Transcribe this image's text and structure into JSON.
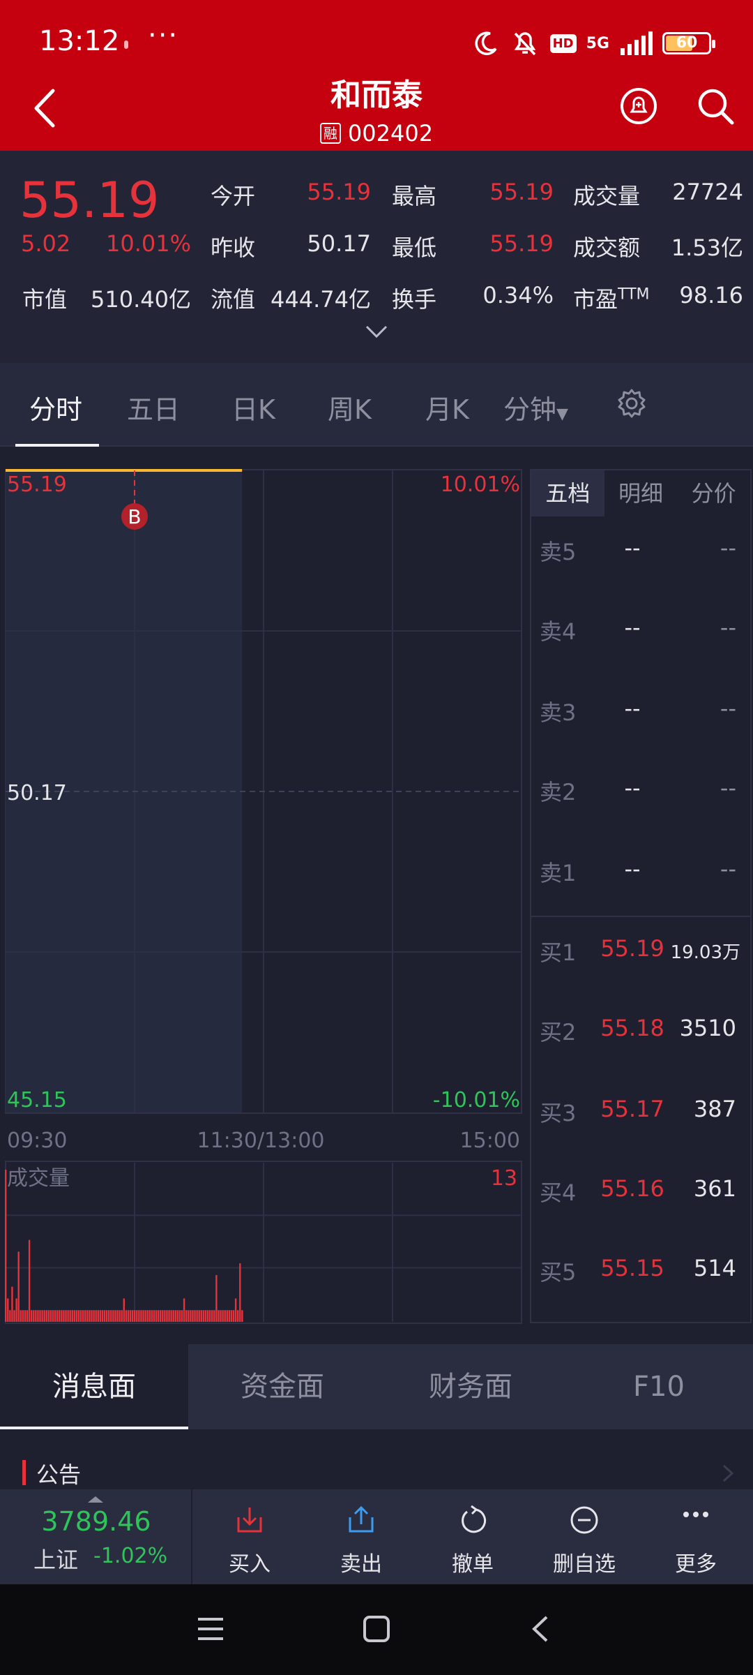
{
  "status_bar": {
    "time": "13:12",
    "more": "···",
    "hd": "HD",
    "net": "5G",
    "battery": "60"
  },
  "header": {
    "title": "和而泰",
    "badge": "融",
    "code": "002402"
  },
  "quote": {
    "price": "55.19",
    "change": "5.02",
    "change_pct": "10.01%",
    "open_label": "今开",
    "open": "55.19",
    "high_label": "最高",
    "high": "55.19",
    "volume_label": "成交量",
    "volume": "27724",
    "prev_close_label": "昨收",
    "prev_close": "50.17",
    "low_label": "最低",
    "low": "55.19",
    "amount_label": "成交额",
    "amount": "1.53亿",
    "mcap_label": "市值",
    "mcap": "510.40亿",
    "float_label": "流值",
    "float": "444.74亿",
    "turnover_label": "换手",
    "turnover": "0.34%",
    "pe_label": "市盈",
    "pe_sup": "TTM",
    "pe": "98.16"
  },
  "chart_tabs": [
    "分时",
    "五日",
    "日K",
    "周K",
    "月K",
    "分钟"
  ],
  "chart": {
    "top_price": "55.19",
    "top_pct": "10.01%",
    "mid_price": "50.17",
    "bottom_price": "45.15",
    "bottom_pct": "-10.01%",
    "marker": "B",
    "time_labels": [
      "09:30",
      "11:30/13:00",
      "15:00"
    ],
    "volume_label": "成交量",
    "volume_max": "13"
  },
  "chart_data": {
    "type": "line",
    "title": "",
    "ylim": [
      45.15,
      55.19
    ],
    "x": [
      0,
      1,
      20,
      40,
      60,
      80,
      100,
      110
    ],
    "series": [
      {
        "values": [
          55.19,
          55.19,
          55.19,
          55.19,
          55.19,
          55.19,
          55.19,
          55.19
        ]
      }
    ],
    "volume": [
      13,
      2,
      1,
      3,
      1,
      2,
      6,
      1,
      1,
      1,
      1,
      7,
      1,
      1,
      1,
      1,
      1,
      1,
      1,
      1,
      1,
      1,
      1,
      1,
      1,
      1,
      1,
      1,
      1,
      1,
      1,
      1,
      1,
      1,
      1,
      1,
      1,
      1,
      1,
      1,
      1,
      1,
      1,
      1,
      1,
      1,
      1,
      1,
      1,
      1,
      1,
      1,
      1,
      1,
      1,
      2,
      1,
      1,
      1,
      1,
      1,
      1,
      1,
      1,
      1,
      1,
      1,
      1,
      1,
      1,
      1,
      1,
      1,
      1,
      1,
      1,
      1,
      1,
      1,
      1,
      1,
      1,
      1,
      2,
      1,
      1,
      1,
      1,
      1,
      1,
      1,
      1,
      1,
      1,
      1,
      1,
      1,
      1,
      4,
      1,
      1,
      1,
      1,
      1,
      1,
      1,
      1,
      2,
      1,
      5,
      1
    ],
    "volume_ylim": [
      0,
      13
    ],
    "total_minutes": 240,
    "grid": true
  },
  "orderbook": {
    "tabs": [
      "五档",
      "明细",
      "分价"
    ],
    "asks": [
      {
        "label": "卖5",
        "price": "--",
        "vol": "--"
      },
      {
        "label": "卖4",
        "price": "--",
        "vol": "--"
      },
      {
        "label": "卖3",
        "price": "--",
        "vol": "--"
      },
      {
        "label": "卖2",
        "price": "--",
        "vol": "--"
      },
      {
        "label": "卖1",
        "price": "--",
        "vol": "--"
      }
    ],
    "bids": [
      {
        "label": "买1",
        "price": "55.19",
        "vol": "19.03万"
      },
      {
        "label": "买2",
        "price": "55.18",
        "vol": "3510"
      },
      {
        "label": "买3",
        "price": "55.17",
        "vol": "387"
      },
      {
        "label": "买4",
        "price": "55.16",
        "vol": "361"
      },
      {
        "label": "买5",
        "price": "55.15",
        "vol": "514"
      }
    ]
  },
  "info_tabs": [
    "消息面",
    "资金面",
    "财务面",
    "F10"
  ],
  "notice": {
    "title": "公告"
  },
  "index": {
    "value": "3789.46",
    "name": "上证",
    "pct": "-1.02%"
  },
  "trade_buttons": {
    "buy": "买入",
    "sell": "卖出",
    "cancel": "撤单",
    "remove": "删自选",
    "more": "更多"
  },
  "colors": {
    "up": "#e5323b",
    "down": "#2fc45a",
    "header": "#c5000f",
    "bg": "#1e2030",
    "price_line": "#f7b731"
  }
}
